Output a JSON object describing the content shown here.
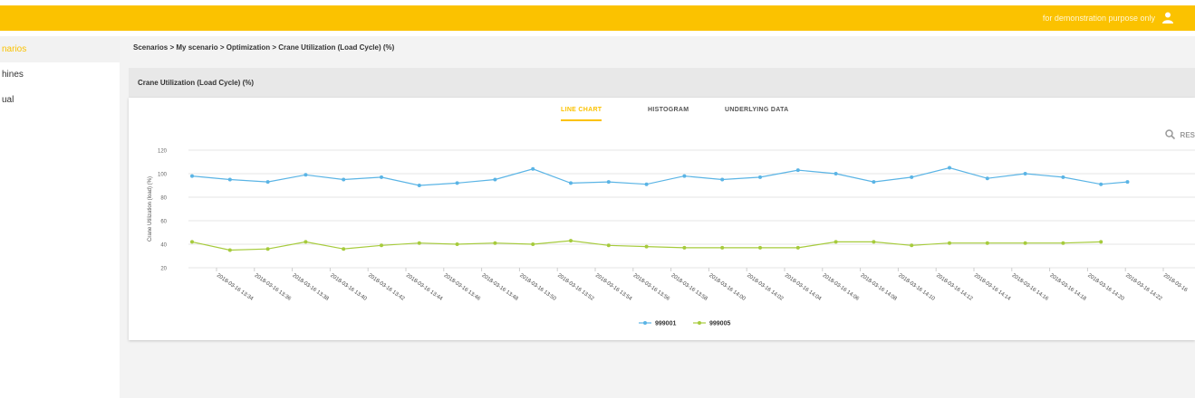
{
  "header": {
    "note": "for demonstration purpose only"
  },
  "sidebar": {
    "items": [
      {
        "label": "narios"
      },
      {
        "label": "hines"
      },
      {
        "label": "ual"
      }
    ]
  },
  "breadcrumb": "Scenarios > My scenario > Optimization > Crane Utilization (Load Cycle) (%)",
  "card": {
    "title": "Crane Utilization (Load Cycle) (%)"
  },
  "tabs": [
    {
      "label": "LINE CHART"
    },
    {
      "label": "HISTOGRAM"
    },
    {
      "label": "UNDERLYING DATA"
    }
  ],
  "reset_label": "RES",
  "colors": {
    "accent": "#fbc200",
    "series1": "#5ab4e5",
    "series2": "#a6cb3c"
  },
  "chart_data": {
    "type": "line",
    "ylabel": "Crane Utilization (load) (%)",
    "ylim": [
      20,
      120
    ],
    "yticks": [
      20,
      40,
      60,
      80,
      100,
      120
    ],
    "xticklabels": [
      "2018-03-16 13:34",
      "2018-03-16 13:36",
      "2018-03-16 13:38",
      "2018-03-16 13:40",
      "2018-03-16 13:42",
      "2018-03-16 13:44",
      "2018-03-16 13:46",
      "2018-03-16 13:48",
      "2018-03-16 13:50",
      "2018-03-16 13:52",
      "2018-03-16 13:54",
      "2018-03-16 13:56",
      "2018-03-16 13:58",
      "2018-03-16 14:00",
      "2018-03-16 14:02",
      "2018-03-16 14:04",
      "2018-03-16 14:06",
      "2018-03-16 14:08",
      "2018-03-16 14:10",
      "2018-03-16 14:12",
      "2018-03-16 14:14",
      "2018-03-16 14:16",
      "2018-03-16 14:18",
      "2018-03-16 14:20",
      "2018-03-16 14:22",
      "2018-03-16"
    ],
    "series": [
      {
        "name": "999001",
        "points": [
          [
            0,
            98
          ],
          [
            1,
            95
          ],
          [
            2,
            93
          ],
          [
            3,
            99
          ],
          [
            4,
            95
          ],
          [
            5,
            97
          ],
          [
            6,
            90
          ],
          [
            7,
            92
          ],
          [
            8,
            95
          ],
          [
            9,
            104
          ],
          [
            10,
            92
          ],
          [
            11,
            93
          ],
          [
            12,
            91
          ],
          [
            13,
            98
          ],
          [
            14,
            95
          ],
          [
            15,
            97
          ],
          [
            16,
            103
          ],
          [
            17,
            100
          ],
          [
            18,
            93
          ],
          [
            19,
            97
          ],
          [
            20,
            105
          ],
          [
            21,
            96
          ],
          [
            22,
            100
          ],
          [
            23,
            97
          ],
          [
            24,
            91
          ],
          [
            24.7,
            93
          ]
        ]
      },
      {
        "name": "999005",
        "points": [
          [
            0,
            42
          ],
          [
            1,
            35
          ],
          [
            2,
            36
          ],
          [
            3,
            42
          ],
          [
            4,
            36
          ],
          [
            5,
            39
          ],
          [
            6,
            41
          ],
          [
            7,
            40
          ],
          [
            8,
            41
          ],
          [
            9,
            40
          ],
          [
            10,
            43
          ],
          [
            11,
            39
          ],
          [
            12,
            38
          ],
          [
            13,
            37
          ],
          [
            14,
            37
          ],
          [
            15,
            37
          ],
          [
            16,
            37
          ],
          [
            17,
            42
          ],
          [
            18,
            42
          ],
          [
            19,
            39
          ],
          [
            20,
            41
          ],
          [
            21,
            41
          ],
          [
            22,
            41
          ],
          [
            23,
            41
          ],
          [
            24,
            42
          ]
        ]
      }
    ],
    "legend": "bottom-center"
  }
}
